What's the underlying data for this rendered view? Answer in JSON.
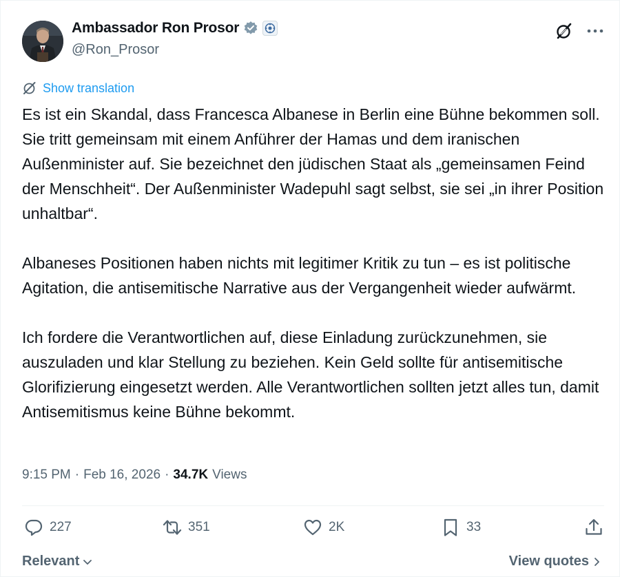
{
  "author": {
    "display_name": "Ambassador Ron Prosor",
    "handle": "@Ron_Prosor",
    "verified": true,
    "avatar_icon": "profile-photo"
  },
  "translate_label": "Show translation",
  "tweet": {
    "paragraphs": [
      "Es ist ein Skandal, dass Francesca Albanese in Berlin eine Bühne bekommen soll. Sie tritt gemeinsam mit einem Anführer der Hamas und dem iranischen Außenminister auf. Sie bezeichnet den jüdischen Staat als „gemeinsamen Feind der Menschheit“. Der Außenminister Wadepuhl sagt selbst, sie sei „in ihrer Position unhaltbar“.",
      "Albaneses Positionen haben nichts mit legitimer Kritik zu tun – es ist politische Agitation, die antisemitische Narrative aus der Vergangenheit wieder aufwärmt.",
      "Ich fordere die Verantwortlichen auf, diese Einladung zurückzunehmen, sie auszuladen und klar Stellung zu beziehen. Kein Geld sollte für antisemitische Glorifizierung eingesetzt werden. Alle Verantwortlichen sollten jetzt alles tun, damit Antisemitismus keine Bühne bekommt."
    ]
  },
  "meta": {
    "time": "9:15 PM",
    "separator": "·",
    "date": "Feb 16, 2026",
    "views_count": "34.7K",
    "views_label": "Views"
  },
  "actions": {
    "replies": "227",
    "reposts": "351",
    "likes": "2K",
    "bookmarks": "33"
  },
  "footer": {
    "sort_label": "Relevant",
    "view_quotes_label": "View quotes"
  },
  "colors": {
    "link_blue": "#1d9bf0",
    "verified_blue": "#829aab",
    "secondary_text": "#536471",
    "primary_text": "#0f1419"
  }
}
